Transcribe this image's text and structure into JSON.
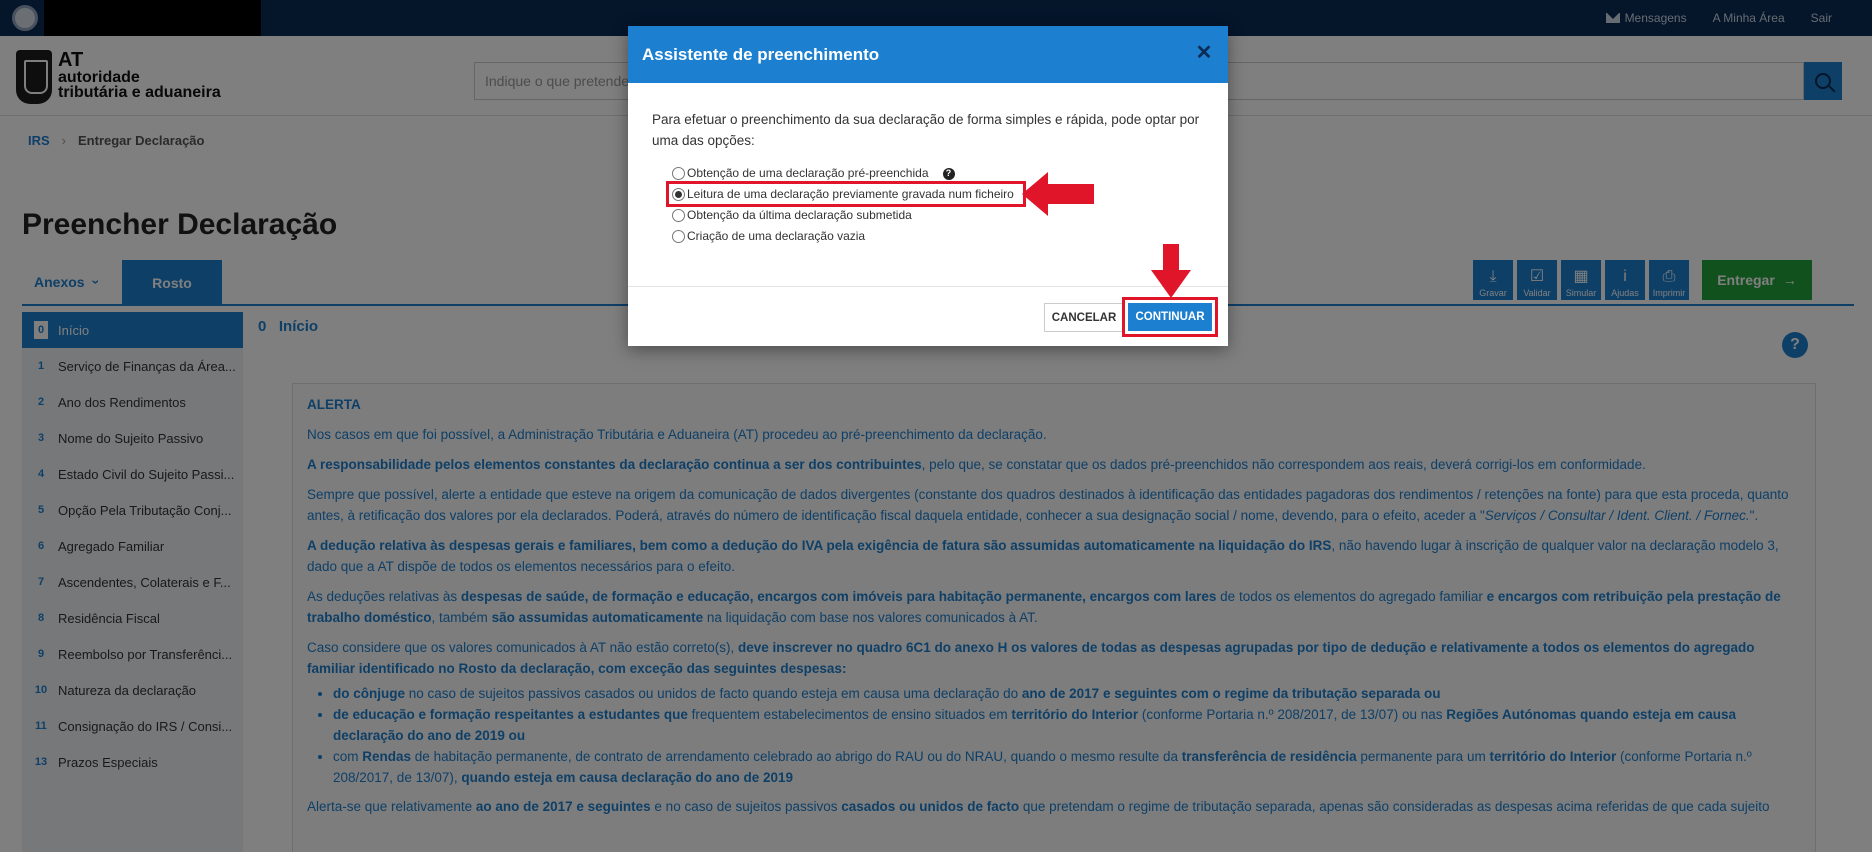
{
  "topbar": {
    "links": [
      "Mensagens",
      "A Minha Área",
      "Sair"
    ]
  },
  "brand": {
    "line1": "AT",
    "line2": "autoridade",
    "line3": "tributária e aduaneira"
  },
  "search": {
    "placeholder": "Indique o que pretende"
  },
  "breadcrumb": {
    "root": "IRS",
    "current": "Entregar Declaração"
  },
  "page": {
    "title": "Preencher Declaração"
  },
  "tabs": {
    "anexos": "Anexos",
    "rosto": "Rosto"
  },
  "toolbar": {
    "buttons": [
      {
        "label": "Gravar",
        "icon": "download-icon"
      },
      {
        "label": "Validar",
        "icon": "check-icon"
      },
      {
        "label": "Simular",
        "icon": "calculator-icon"
      },
      {
        "label": "Ajudas",
        "icon": "info-icon"
      },
      {
        "label": "Imprimir",
        "icon": "print-icon"
      }
    ],
    "entregar": "Entregar"
  },
  "sidebar": {
    "items": [
      {
        "num": "0",
        "label": "Início"
      },
      {
        "num": "1",
        "label": "Serviço de Finanças da Área..."
      },
      {
        "num": "2",
        "label": "Ano dos Rendimentos"
      },
      {
        "num": "3",
        "label": "Nome do Sujeito Passivo"
      },
      {
        "num": "4",
        "label": "Estado Civil do Sujeito Passi..."
      },
      {
        "num": "5",
        "label": "Opção Pela Tributação Conj..."
      },
      {
        "num": "6",
        "label": "Agregado Familiar"
      },
      {
        "num": "7",
        "label": "Ascendentes, Colaterais e F..."
      },
      {
        "num": "8",
        "label": "Residência Fiscal"
      },
      {
        "num": "9",
        "label": "Reembolso por Transferênci..."
      },
      {
        "num": "10",
        "label": "Natureza da declaração"
      },
      {
        "num": "11",
        "label": "Consignação do IRS / Consi..."
      },
      {
        "num": "13",
        "label": "Prazos Especiais"
      }
    ]
  },
  "section": {
    "num": "0",
    "title": "Início"
  },
  "alert": {
    "title": "ALERTA",
    "p1": "Nos casos em que foi possível, a Administração Tributária e Aduaneira (AT) procedeu ao pré-preenchimento da declaração.",
    "p2_bold": "A responsabilidade pelos elementos constantes da declaração continua a ser dos contribuintes",
    "p2_rest": ", pelo que, se constatar que os dados pré-preenchidos não correspondem aos reais, deverá corrigi-los em conformidade.",
    "p3": "Sempre que possível, alerte a entidade que esteve na origem da comunicação de dados divergentes (constante dos quadros destinados à identificação das entidades pagadoras dos rendimentos / retenções na fonte) para que esta proceda, quanto antes, à retificação dos valores por ela declarados. Poderá, através do número de identificação fiscal daquela entidade, conhecer a sua designação social / nome, devendo, para o efeito, aceder a \"",
    "p3_italic": "Serviços / Consultar / Ident. Client. / Fornec.",
    "p3_end": "\".",
    "p4_bold": "A dedução relativa às despesas gerais e familiares, bem como a dedução do IVA pela exigência de fatura são assumidas automaticamente na liquidação do IRS",
    "p4_rest": ", não havendo lugar à inscrição de qualquer valor na declaração modelo 3, dado que a AT dispõe de todos os elementos necessários para o efeito.",
    "p5_a": "As deduções relativas às ",
    "p5_b": "despesas de saúde, de formação e educação, encargos com imóveis para habitação permanente, encargos com lares",
    "p5_c": " de todos os elementos do agregado familiar ",
    "p5_d": "e encargos com retribuição pela prestação de trabalho doméstico",
    "p5_e": ", também ",
    "p5_f": "são assumidas automaticamente",
    "p5_g": " na liquidação com base nos valores comunicados à AT.",
    "p6_a": "Caso considere que os valores comunicados à AT não estão correto(s), ",
    "p6_b": "deve inscrever no quadro 6C1 do anexo H os valores de todas as despesas agrupadas por tipo de dedução e relativamente a todos os elementos do agregado familiar identificado no Rosto da declaração, com exceção das seguintes despesas:",
    "li1_a": "do cônjuge",
    "li1_b": " no caso de sujeitos passivos casados ou unidos de facto quando esteja em causa uma declaração do ",
    "li1_c": "ano de 2017 e seguintes com o regime da tributação separada ou",
    "li2_a": "de educação e formação respeitantes a estudantes que",
    "li2_b": " frequentem estabelecimentos de ensino situados em ",
    "li2_c": "território do Interior",
    "li2_d": " (conforme Portaria n.º 208/2017, de 13/07) ou nas ",
    "li2_e": "Regiões Autónomas quando esteja em causa declaração do ano de 2019 ou",
    "li3_a": "com ",
    "li3_b": "Rendas",
    "li3_c": " de habitação permanente, de contrato de arrendamento celebrado ao abrigo do RAU ou do NRAU, quando o mesmo resulte da ",
    "li3_d": "transferência de residência",
    "li3_e": " permanente para um ",
    "li3_f": "território do Interior",
    "li3_g": " (conforme Portaria n.º 208/2017, de 13/07), ",
    "li3_h": "quando esteja em causa declaração do ano de 2019",
    "p7_a": "Alerta-se que relativamente ",
    "p7_b": "ao ano de 2017 e seguintes",
    "p7_c": " e no caso de sujeitos passivos ",
    "p7_d": "casados ou unidos de facto",
    "p7_e": " que pretendam o regime de tributação separada, apenas são consideradas as despesas acima referidas de que cada sujeito"
  },
  "modal": {
    "title": "Assistente de preenchimento",
    "intro": "Para efetuar o preenchimento da sua declaração de forma simples e rápida, pode optar por uma das opções:",
    "options": [
      "Obtenção de uma declaração pré-preenchida",
      "Leitura de uma declaração previamente gravada num ficheiro",
      "Obtenção da última declaração submetida",
      "Criação de uma declaração vazia"
    ],
    "selected_index": 1,
    "cancel": "CANCELAR",
    "continue": "CONTINUAR"
  },
  "colors": {
    "primary": "#1d7fcf",
    "dark_navy": "#0a2b54",
    "green": "#23a33a",
    "highlight_red": "#e0152a"
  }
}
